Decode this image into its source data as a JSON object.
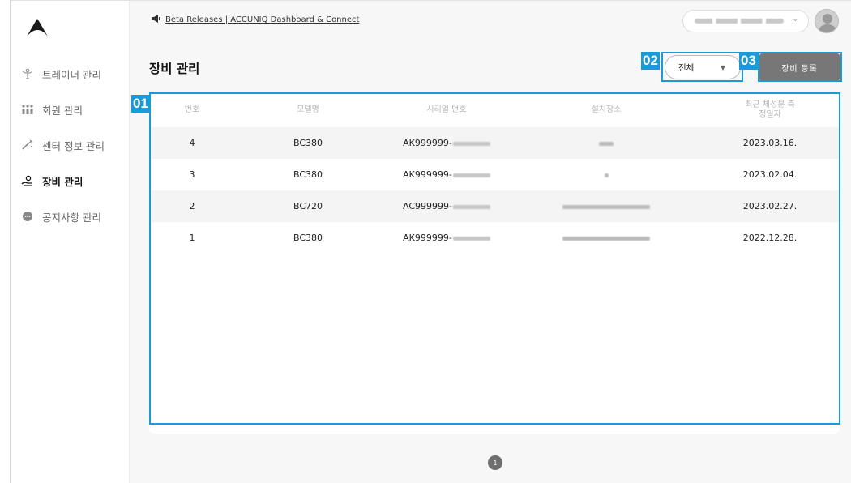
{
  "sidebar": {
    "items": [
      {
        "label": "트레이너 관리",
        "icon": "trainer-icon",
        "active": false
      },
      {
        "label": "회원 관리",
        "icon": "members-icon",
        "active": false
      },
      {
        "label": "센터 정보 관리",
        "icon": "tools-icon",
        "active": false
      },
      {
        "label": "장비 관리",
        "icon": "equipment-hand-icon",
        "active": true
      },
      {
        "label": "공지사항 관리",
        "icon": "chat-bubble-icon",
        "active": false
      }
    ]
  },
  "header": {
    "announcement": "Beta Releases | ACCUNIQ Dashboard & Connect"
  },
  "page": {
    "title": "장비 관리",
    "filter_value": "전체",
    "register_label": "장비 등록"
  },
  "annotations": {
    "table": "01",
    "filter": "02",
    "register": "03"
  },
  "table": {
    "headers": [
      "번호",
      "모델명",
      "시리얼 번호",
      "설치장소",
      "최근 체성분 측정일자"
    ],
    "rows": [
      {
        "no": "4",
        "model": "BC380",
        "serial": "AK999999-",
        "date": "2023.03.16."
      },
      {
        "no": "3",
        "model": "BC380",
        "serial": "AK999999-",
        "date": "2023.02.04."
      },
      {
        "no": "2",
        "model": "BC720",
        "serial": "AC999999-",
        "date": "2023.02.27."
      },
      {
        "no": "1",
        "model": "BC380",
        "serial": "AK999999-",
        "date": "2022.12.28."
      }
    ]
  },
  "pagination": {
    "current_page": "1"
  },
  "colors": {
    "highlight": "#1a9ad6",
    "button": "#777777"
  }
}
